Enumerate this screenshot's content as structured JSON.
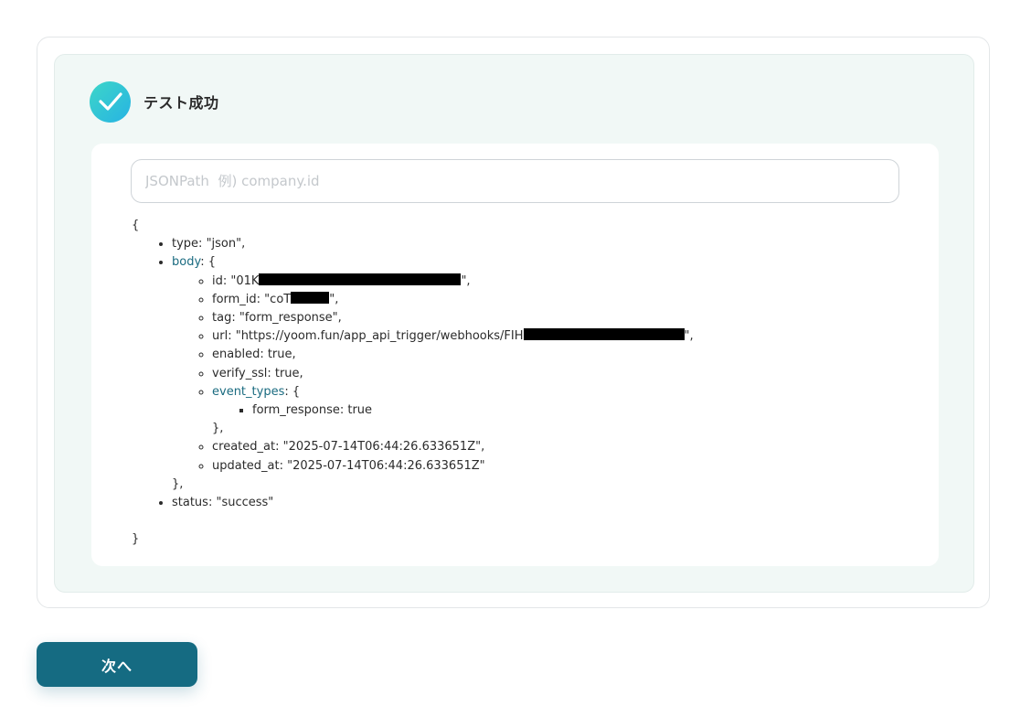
{
  "status": {
    "label": "テスト成功",
    "icon": "check-circle-icon",
    "colors": {
      "gradient_start": "#3dd6c8",
      "gradient_end": "#27b3e3"
    }
  },
  "jsonpath": {
    "placeholder": "JSONPath  例) company.id",
    "value": ""
  },
  "json": {
    "open_brace": "{",
    "close_brace": "}",
    "type": {
      "key": "type",
      "value": "\"json\","
    },
    "body": {
      "key": "body",
      "open": ": {",
      "close": "},",
      "id": {
        "prefix": "id: \"01K",
        "suffix": "\","
      },
      "form_id": {
        "prefix": "form_id: \"coT",
        "suffix": "\","
      },
      "tag": "tag: \"form_response\",",
      "url": {
        "prefix": "url: \"https://yoom.fun/app_api_trigger/webhooks/FIH",
        "suffix": "\","
      },
      "enabled": "enabled: true,",
      "verify_ssl": "verify_ssl: true,",
      "event_types": {
        "key": "event_types",
        "open": ": {",
        "item": "form_response: true",
        "close": "},"
      },
      "created_at": "created_at: \"2025-07-14T06:44:26.633651Z\",",
      "updated_at": "updated_at: \"2025-07-14T06:44:26.633651Z\""
    },
    "status_line": "status: \"success\""
  },
  "next_button": {
    "label": "次へ",
    "color": "#156b82"
  },
  "colors": {
    "panel_bg": "#f1f8f6",
    "link_key": "#1a6b80"
  }
}
